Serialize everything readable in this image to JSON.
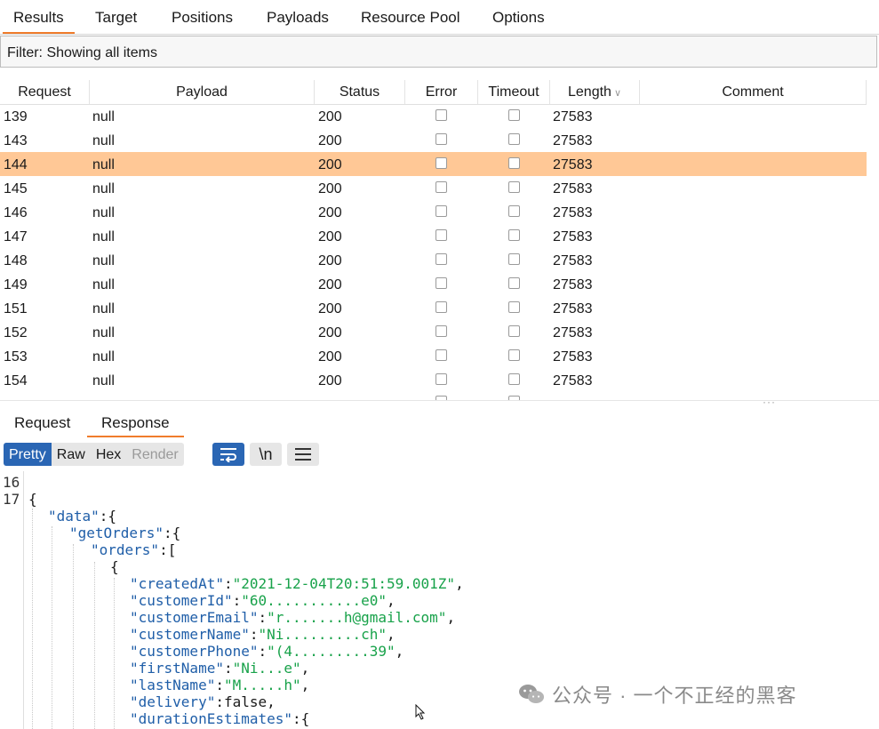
{
  "top_tabs": [
    "Results",
    "Target",
    "Positions",
    "Payloads",
    "Resource Pool",
    "Options"
  ],
  "filter": {
    "text": "Filter: Showing all items"
  },
  "table": {
    "columns": [
      "Request",
      "Payload",
      "Status",
      "Error",
      "Timeout",
      "Length",
      "Comment"
    ],
    "sort_column": "Length",
    "rows": [
      {
        "request": "139",
        "payload": "null",
        "status": "200",
        "length": "27583"
      },
      {
        "request": "143",
        "payload": "null",
        "status": "200",
        "length": "27583"
      },
      {
        "request": "144",
        "payload": "null",
        "status": "200",
        "length": "27583",
        "selected": true
      },
      {
        "request": "145",
        "payload": "null",
        "status": "200",
        "length": "27583"
      },
      {
        "request": "146",
        "payload": "null",
        "status": "200",
        "length": "27583"
      },
      {
        "request": "147",
        "payload": "null",
        "status": "200",
        "length": "27583"
      },
      {
        "request": "148",
        "payload": "null",
        "status": "200",
        "length": "27583"
      },
      {
        "request": "149",
        "payload": "null",
        "status": "200",
        "length": "27583"
      },
      {
        "request": "151",
        "payload": "null",
        "status": "200",
        "length": "27583"
      },
      {
        "request": "152",
        "payload": "null",
        "status": "200",
        "length": "27583"
      },
      {
        "request": "153",
        "payload": "null",
        "status": "200",
        "length": "27583"
      },
      {
        "request": "154",
        "payload": "null",
        "status": "200",
        "length": "27583"
      }
    ],
    "selected_color": "#ffc896"
  },
  "bottom_tabs": [
    "Request",
    "Response"
  ],
  "bottom_active": "Response",
  "view_modes": [
    "Pretty",
    "Raw",
    "Hex",
    "Render"
  ],
  "view_active": "Pretty",
  "toolbar_icons": [
    "word-wrap-icon",
    "newline-icon",
    "menu-icon"
  ],
  "newline_label": "\\n",
  "code": {
    "line_numbers": [
      "16",
      "17"
    ],
    "lines": [
      {
        "text": "{"
      },
      {
        "key": "\"data\"",
        "rest": ":{"
      },
      {
        "key": "\"getOrders\"",
        "rest": ":{"
      },
      {
        "key": "\"orders\"",
        "rest": ":["
      },
      {
        "text": "{"
      },
      {
        "key": "\"createdAt\"",
        "colon": ":",
        "str": "\"2021-12-04T20:51:59.001Z\"",
        "tail": ","
      },
      {
        "key": "\"customerId\"",
        "colon": ":",
        "str": "\"60...........e0\"",
        "tail": ","
      },
      {
        "key": "\"customerEmail\"",
        "colon": ":",
        "str": "\"r.......h@gmail.com\"",
        "tail": ","
      },
      {
        "key": "\"customerName\"",
        "colon": ":",
        "str": "\"Ni.........ch\"",
        "tail": ","
      },
      {
        "key": "\"customerPhone\"",
        "colon": ":",
        "str": "\"(4.........39\"",
        "tail": ","
      },
      {
        "key": "\"firstName\"",
        "colon": ":",
        "str": "\"Ni...e\"",
        "tail": ","
      },
      {
        "key": "\"lastName\"",
        "colon": ":",
        "str": "\"M.....h\"",
        "tail": ","
      },
      {
        "key": "\"delivery\"",
        "rest": ":false,"
      },
      {
        "key": "\"durationEstimates\"",
        "rest": ":{"
      }
    ]
  },
  "watermark": "公众号 · 一个不正经的黑客",
  "colors": {
    "accent": "#f07c2c",
    "active_button": "#2a66b4",
    "json_key": "#1f5ea8",
    "json_string": "#18a24a"
  }
}
